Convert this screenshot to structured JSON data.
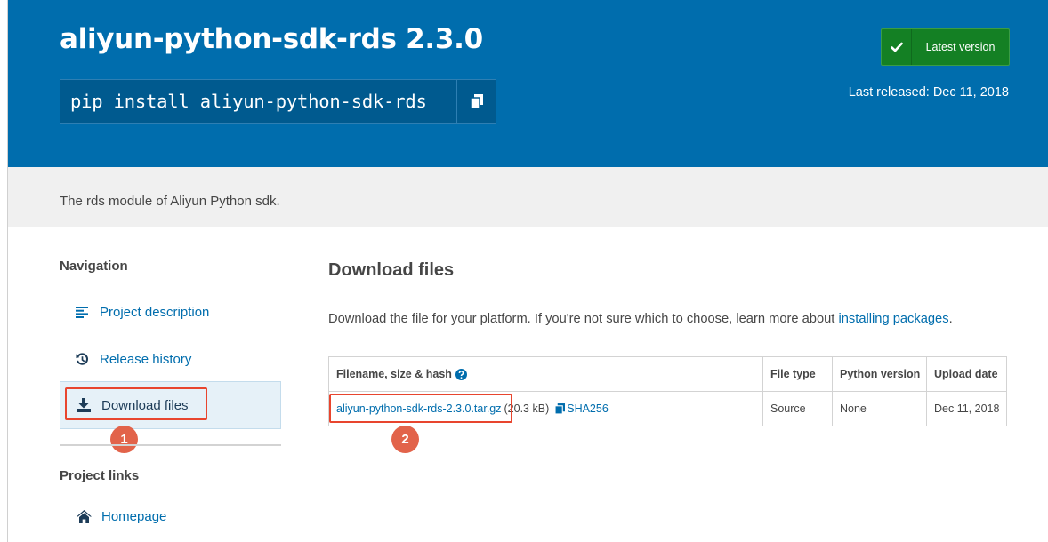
{
  "header": {
    "package_title": "aliyun-python-sdk-rds 2.3.0",
    "pip_command": "pip install aliyun-python-sdk-rds",
    "latest_version_label": "Latest version",
    "last_released": "Last released: Dec 11, 2018"
  },
  "summary": {
    "text": "The rds module of Aliyun Python sdk."
  },
  "sidebar": {
    "navigation_heading": "Navigation",
    "items": [
      {
        "label": "Project description",
        "icon": "align-left-icon",
        "active": false
      },
      {
        "label": "Release history",
        "icon": "history-icon",
        "active": false
      },
      {
        "label": "Download files",
        "icon": "download-icon",
        "active": true
      }
    ],
    "project_links_heading": "Project links",
    "links": [
      {
        "label": "Homepage",
        "icon": "home-icon"
      }
    ]
  },
  "main": {
    "heading": "Download files",
    "intro_text": "Download the file for your platform. If you're not sure which to choose, learn more about ",
    "intro_link": "installing packages",
    "intro_end": ".",
    "table": {
      "headers": [
        "Filename, size & hash",
        "File type",
        "Python version",
        "Upload date"
      ],
      "rows": [
        {
          "filename": "aliyun-python-sdk-rds-2.3.0.tar.gz",
          "size": "(20.3 kB)",
          "hash_label": "SHA256",
          "file_type": "Source",
          "python_version": "None",
          "upload_date": "Dec 11, 2018"
        }
      ]
    }
  },
  "annotations": {
    "badge_1": "1",
    "badge_2": "2",
    "highlight_color": "#e8452e",
    "badge_color": "#e2634a"
  },
  "colors": {
    "header_bg": "#006dad",
    "link": "#006dad",
    "latest_button": "#148024",
    "summary_bg": "#f0f0f0"
  }
}
